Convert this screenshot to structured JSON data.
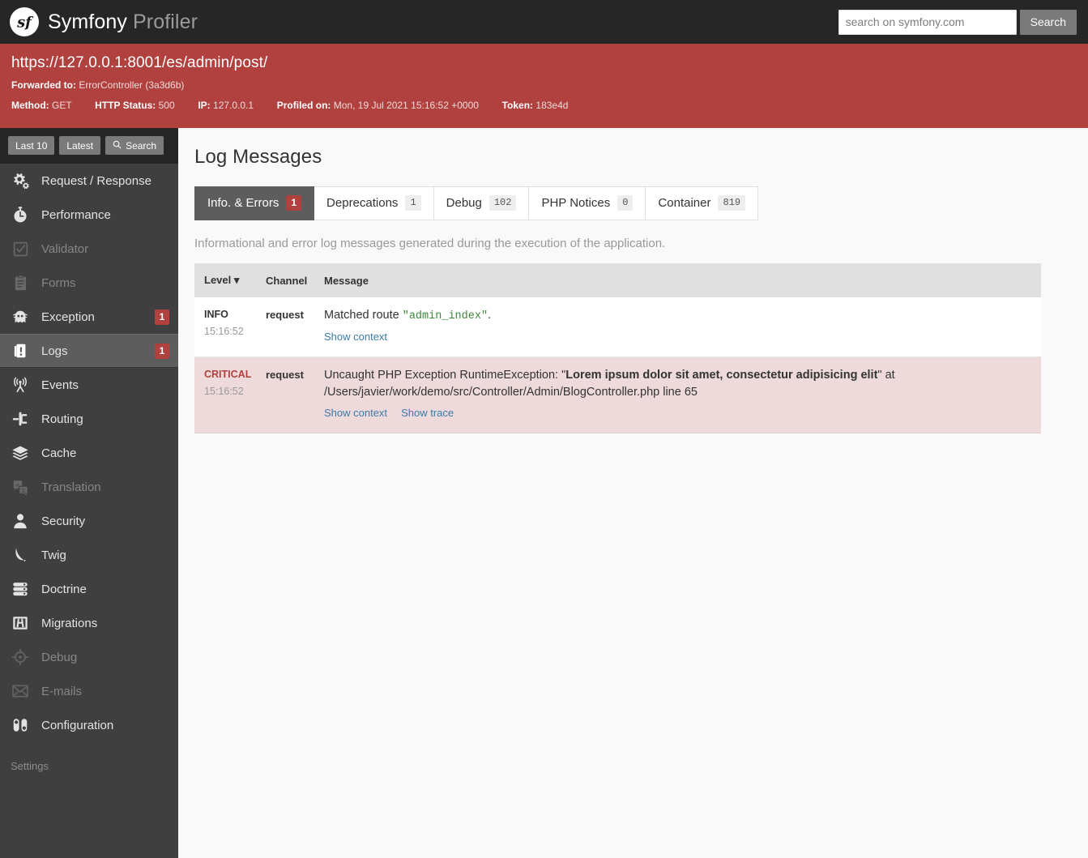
{
  "topbar": {
    "logo_icon": "symfony-logo-icon",
    "brand_main": "Symfony",
    "brand_sub": "Profiler",
    "search_placeholder": "search on symfony.com",
    "search_value": "",
    "search_button": "Search"
  },
  "banner": {
    "url": "https://127.0.0.1:8001/es/admin/post/",
    "forwarded_label": "Forwarded to:",
    "forwarded_value": "ErrorController (3a3d6b)",
    "method_label": "Method:",
    "method_value": "GET",
    "status_label": "HTTP Status:",
    "status_value": "500",
    "ip_label": "IP:",
    "ip_value": "127.0.0.1",
    "profiled_label": "Profiled on:",
    "profiled_value": "Mon, 19 Jul 2021 15:16:52 +0000",
    "token_label": "Token:",
    "token_value": "183e4d",
    "background_color": "#b0413e"
  },
  "sidebar": {
    "actions": [
      {
        "label": "Last 10",
        "icon": ""
      },
      {
        "label": "Latest",
        "icon": ""
      },
      {
        "label": "Search",
        "icon": "magnifier-icon"
      }
    ],
    "items": [
      {
        "label": "Request / Response",
        "icon": "gears-icon",
        "badge": "",
        "state": "enabled"
      },
      {
        "label": "Performance",
        "icon": "stopwatch-icon",
        "badge": "",
        "state": "enabled"
      },
      {
        "label": "Validator",
        "icon": "checkbox-icon",
        "badge": "",
        "state": "disabled"
      },
      {
        "label": "Forms",
        "icon": "clipboard-icon",
        "badge": "",
        "state": "disabled"
      },
      {
        "label": "Exception",
        "icon": "ghost-icon",
        "badge": "1",
        "state": "enabled"
      },
      {
        "label": "Logs",
        "icon": "log-document-icon",
        "badge": "1",
        "state": "active"
      },
      {
        "label": "Events",
        "icon": "antenna-icon",
        "badge": "",
        "state": "enabled"
      },
      {
        "label": "Routing",
        "icon": "routing-fork-icon",
        "badge": "",
        "state": "enabled"
      },
      {
        "label": "Cache",
        "icon": "layers-icon",
        "badge": "",
        "state": "enabled"
      },
      {
        "label": "Translation",
        "icon": "translation-icon",
        "badge": "",
        "state": "disabled"
      },
      {
        "label": "Security",
        "icon": "user-icon",
        "badge": "",
        "state": "enabled"
      },
      {
        "label": "Twig",
        "icon": "twig-leaf-icon",
        "badge": "",
        "state": "enabled"
      },
      {
        "label": "Doctrine",
        "icon": "database-icon",
        "badge": "",
        "state": "enabled"
      },
      {
        "label": "Migrations",
        "icon": "migrations-icon",
        "badge": "",
        "state": "enabled"
      },
      {
        "label": "Debug",
        "icon": "crosshair-icon",
        "badge": "",
        "state": "disabled"
      },
      {
        "label": "E-mails",
        "icon": "envelope-icon",
        "badge": "",
        "state": "disabled"
      },
      {
        "label": "Configuration",
        "icon": "toggles-icon",
        "badge": "",
        "state": "enabled"
      }
    ],
    "settings_label": "Settings",
    "badge_color": "#b0413e"
  },
  "main": {
    "page_title": "Log Messages",
    "tabs": [
      {
        "label": "Info. & Errors",
        "count": "1",
        "active": true
      },
      {
        "label": "Deprecations",
        "count": "1",
        "active": false
      },
      {
        "label": "Debug",
        "count": "102",
        "active": false
      },
      {
        "label": "PHP Notices",
        "count": "0",
        "active": false
      },
      {
        "label": "Container",
        "count": "819",
        "active": false
      }
    ],
    "help_text": "Informational and error log messages generated during the execution of the application.",
    "table": {
      "columns": [
        "Level",
        "Channel",
        "Message"
      ],
      "sort_indicator": "chevron-down-icon",
      "rows": [
        {
          "level": "INFO",
          "time": "15:16:52",
          "channel": "request",
          "message_pre": "Matched route ",
          "message_code": "\"admin_index\"",
          "message_post": ".",
          "message_bold": "",
          "message_tail": "",
          "links": [
            "Show context"
          ]
        },
        {
          "level": "CRITICAL",
          "time": "15:16:52",
          "channel": "request",
          "message_pre": "Uncaught PHP Exception RuntimeException: \"",
          "message_code": "",
          "message_bold": "Lorem ipsum dolor sit amet, consectetur adipisicing elit",
          "message_post": "\" at",
          "message_tail": "/Users/javier/work/demo/src/Controller/Admin/BlogController.php line 65",
          "links": [
            "Show context",
            "Show trace"
          ]
        }
      ]
    }
  }
}
